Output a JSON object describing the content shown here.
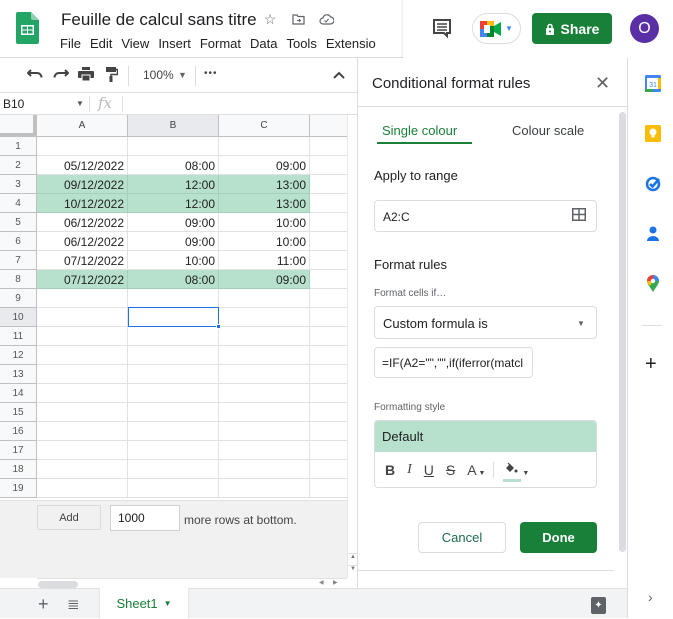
{
  "app": {
    "doc_title": "Feuille de calcul sans titre",
    "title_icons": [
      "star-icon",
      "move-to-folder-icon",
      "cloud-status-icon"
    ],
    "menu": [
      "File",
      "Edit",
      "View",
      "Insert",
      "Format",
      "Data",
      "Tools",
      "Extensio"
    ],
    "share_label": "Share",
    "avatar_initial": "O"
  },
  "toolbar": {
    "zoom": "100%",
    "more": "•••"
  },
  "formula_bar": {
    "namebox": "B10",
    "fx": "fx",
    "value": ""
  },
  "sheet": {
    "columns": [
      "A",
      "B",
      "C"
    ],
    "selected_column": "B",
    "selected_row": 10,
    "highlight_color": "#b7e1cd",
    "rows": [
      {
        "num": "1",
        "cells": [
          "",
          "",
          ""
        ],
        "hl": false
      },
      {
        "num": "2",
        "cells": [
          "05/12/2022",
          "08:00",
          "09:00"
        ],
        "hl": false
      },
      {
        "num": "3",
        "cells": [
          "09/12/2022",
          "12:00",
          "13:00"
        ],
        "hl": true
      },
      {
        "num": "4",
        "cells": [
          "10/12/2022",
          "12:00",
          "13:00"
        ],
        "hl": true
      },
      {
        "num": "5",
        "cells": [
          "06/12/2022",
          "09:00",
          "10:00"
        ],
        "hl": false
      },
      {
        "num": "6",
        "cells": [
          "06/12/2022",
          "09:00",
          "10:00"
        ],
        "hl": false
      },
      {
        "num": "7",
        "cells": [
          "07/12/2022",
          "10:00",
          "11:00"
        ],
        "hl": false
      },
      {
        "num": "8",
        "cells": [
          "07/12/2022",
          "08:00",
          "09:00"
        ],
        "hl": true
      },
      {
        "num": "9",
        "cells": [
          "",
          "",
          ""
        ],
        "hl": false
      },
      {
        "num": "10",
        "cells": [
          "",
          "",
          ""
        ],
        "hl": false
      },
      {
        "num": "11",
        "cells": [
          "",
          "",
          ""
        ],
        "hl": false
      },
      {
        "num": "12",
        "cells": [
          "",
          "",
          ""
        ],
        "hl": false
      },
      {
        "num": "13",
        "cells": [
          "",
          "",
          ""
        ],
        "hl": false
      },
      {
        "num": "14",
        "cells": [
          "",
          "",
          ""
        ],
        "hl": false
      },
      {
        "num": "15",
        "cells": [
          "",
          "",
          ""
        ],
        "hl": false
      },
      {
        "num": "16",
        "cells": [
          "",
          "",
          ""
        ],
        "hl": false
      },
      {
        "num": "17",
        "cells": [
          "",
          "",
          ""
        ],
        "hl": false
      },
      {
        "num": "18",
        "cells": [
          "",
          "",
          ""
        ],
        "hl": false
      },
      {
        "num": "19",
        "cells": [
          "",
          "",
          ""
        ],
        "hl": false
      }
    ],
    "add_rows": {
      "button": "Add",
      "count": "1000",
      "label": "more rows at bottom."
    },
    "tab_name": "Sheet1"
  },
  "panel": {
    "title": "Conditional format rules",
    "tabs": [
      "Single colour",
      "Colour scale"
    ],
    "active_tab": "Single colour",
    "apply_to_range_label": "Apply to range",
    "range_value": "A2:C",
    "format_rules_label": "Format rules",
    "format_cells_if_label": "Format cells if…",
    "condition": "Custom formula is",
    "formula_value": "=IF(A2=\"\",\"\",if(iferror(matcl",
    "formatting_style_label": "Formatting style",
    "style_preview": "Default",
    "style_tools": {
      "bold": "B",
      "italic": "I",
      "underline": "U",
      "strikethrough": "S",
      "text_color": "A"
    },
    "fill_color": "#b7e1cd",
    "cancel_label": "Cancel",
    "done_label": "Done"
  },
  "colors": {
    "brand_green": "#188038",
    "selection_blue": "#1a73e8",
    "avatar_purple": "#5a2fa5"
  }
}
